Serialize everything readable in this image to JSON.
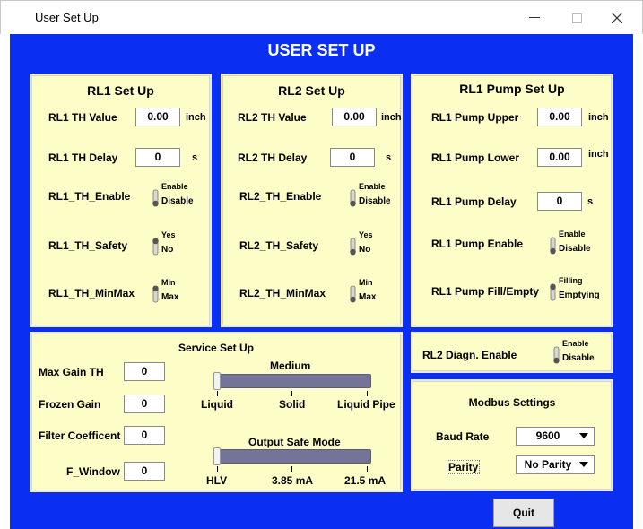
{
  "window": {
    "title": "User Set Up",
    "min_icon": "minimize-icon",
    "max_icon": "maximize-icon",
    "close_icon": "close-icon"
  },
  "header": {
    "title": "USER SET UP"
  },
  "rl1": {
    "title": "RL1 Set Up",
    "th_value_label": "RL1 TH Value",
    "th_value": "0.00",
    "th_value_unit": "inch",
    "th_delay_label": "RL1 TH Delay",
    "th_delay": "0",
    "th_delay_unit": "s",
    "enable_label": "RL1_TH_Enable",
    "enable_on": "Enable",
    "enable_off": "Disable",
    "safety_label": "RL1_TH_Safety",
    "safety_on": "Yes",
    "safety_off": "No",
    "minmax_label": "RL1_TH_MinMax",
    "minmax_on": "Min",
    "minmax_off": "Max"
  },
  "rl2": {
    "title": "RL2 Set Up",
    "th_value_label": "RL2 TH Value",
    "th_value": "0.00",
    "th_value_unit": "inch",
    "th_delay_label": "RL2 TH Delay",
    "th_delay": "0",
    "th_delay_unit": "s",
    "enable_label": "RL2_TH_Enable",
    "enable_on": "Enable",
    "enable_off": "Disable",
    "safety_label": "RL2_TH_Safety",
    "safety_on": "Yes",
    "safety_off": "No",
    "minmax_label": "RL2_TH_MinMax",
    "minmax_on": "Min",
    "minmax_off": "Max"
  },
  "pump": {
    "title": "RL1 Pump Set Up",
    "upper_label": "RL1 Pump Upper",
    "upper": "0.00",
    "upper_unit": "inch",
    "lower_label": "RL1 Pump Lower",
    "lower": "0.00",
    "lower_unit": "inch",
    "delay_label": "RL1 Pump Delay",
    "delay": "0",
    "delay_unit": "s",
    "enable_label": "RL1 Pump Enable",
    "enable_on": "Enable",
    "enable_off": "Disable",
    "fill_label": "RL1 Pump Fill/Empty",
    "fill_on": "Filling",
    "fill_off": "Emptying"
  },
  "service": {
    "title": "Service Set Up",
    "max_gain_label": "Max Gain TH",
    "max_gain": "0",
    "frozen_gain_label": "Frozen Gain",
    "frozen_gain": "0",
    "filter_label": "Filter Coefficent",
    "filter": "0",
    "fwindow_label": "F_Window",
    "fwindow": "0",
    "medium_label": "Medium",
    "medium_options": [
      "Liquid",
      "Solid",
      "Liquid Pipe"
    ],
    "medium_selected": "Liquid",
    "safe_label": "Output Safe Mode",
    "safe_options": [
      "HLV",
      "3.85 mA",
      "21.5 mA"
    ],
    "safe_selected": "HLV"
  },
  "diag": {
    "label": "RL2 Diagn. Enable",
    "on": "Enable",
    "off": "Disable"
  },
  "modbus": {
    "title": "Modbus Settings",
    "baud_label": "Baud Rate",
    "baud": "9600",
    "parity_label": "Parity",
    "parity": "No Parity"
  },
  "quit_label": "Quit",
  "colors": {
    "background": "#0a2ff0",
    "panel": "#fdfdc8",
    "slider": "#737497"
  }
}
